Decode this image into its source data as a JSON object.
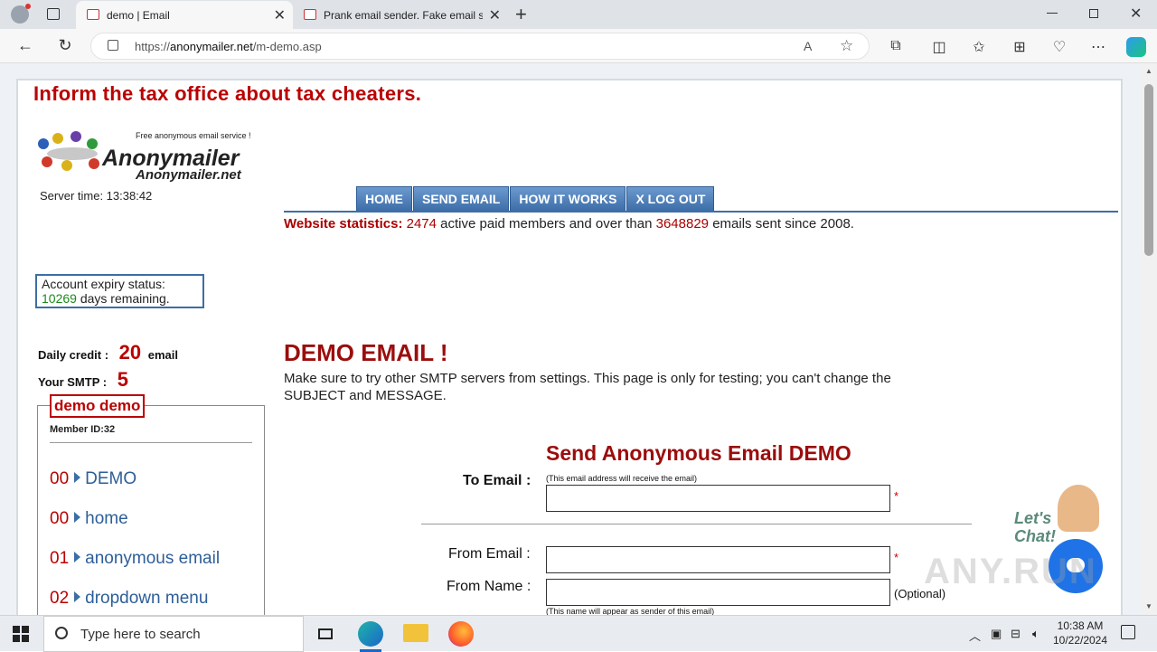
{
  "browser": {
    "tabs": [
      {
        "label": "demo | Email",
        "active": true
      },
      {
        "label": "Prank email sender. Fake email se",
        "active": false
      }
    ],
    "url_prefix": "https://",
    "url_host": "anonymailer.net",
    "url_path": "/m-demo.asp"
  },
  "page": {
    "banner": "Inform the tax office about tax cheaters.",
    "logo": {
      "tagline": "Free anonymous email service !",
      "title": "Anonymailer",
      "subtitle": "Anonymailer.net"
    },
    "server_time": "Server time: 13:38:42",
    "menu": [
      "HOME",
      "SEND EMAIL",
      "HOW IT WORKS",
      "X LOG OUT"
    ],
    "stats": {
      "label": "Website statistics:",
      "members": "2474",
      "mid_text": "active paid members and over  than",
      "emails": "3648829",
      "end_text": "emails sent since 2008."
    },
    "expiry": {
      "label": "Account expiry status:",
      "days": "10269",
      "days_text": "days remaining."
    },
    "credit": {
      "daily_label": "Daily credit   :",
      "daily_value": "20",
      "daily_unit": "email",
      "smtp_label": "Your SMTP   :",
      "smtp_value": "5"
    },
    "member": {
      "name": "demo demo",
      "id": "Member ID:32",
      "nav": [
        {
          "num": "00",
          "label": "DEMO"
        },
        {
          "num": "00",
          "label": "home"
        },
        {
          "num": "01",
          "label": "anonymous email"
        },
        {
          "num": "02",
          "label": "dropdown menu"
        }
      ]
    },
    "demo": {
      "heading": "DEMO EMAIL !",
      "text": "Make sure to try other SMTP servers from settings. This page is only for testing; you can't change the SUBJECT and MESSAGE."
    },
    "form": {
      "heading": "Send Anonymous Email DEMO",
      "to_label": "To Email :",
      "to_hint": "(This email address will receive the email)",
      "from_email_label": "From Email :",
      "from_name_label": "From Name :",
      "optional": "(Optional)",
      "from_name_hint": "(This name will appear as sender of this email)",
      "required_mark": "*"
    },
    "chat": {
      "line1": "Let's",
      "line2": "Chat!"
    },
    "watermark": "ANY.RUN"
  },
  "taskbar": {
    "search_placeholder": "Type here to search",
    "time": "10:38 AM",
    "date": "10/22/2024"
  }
}
